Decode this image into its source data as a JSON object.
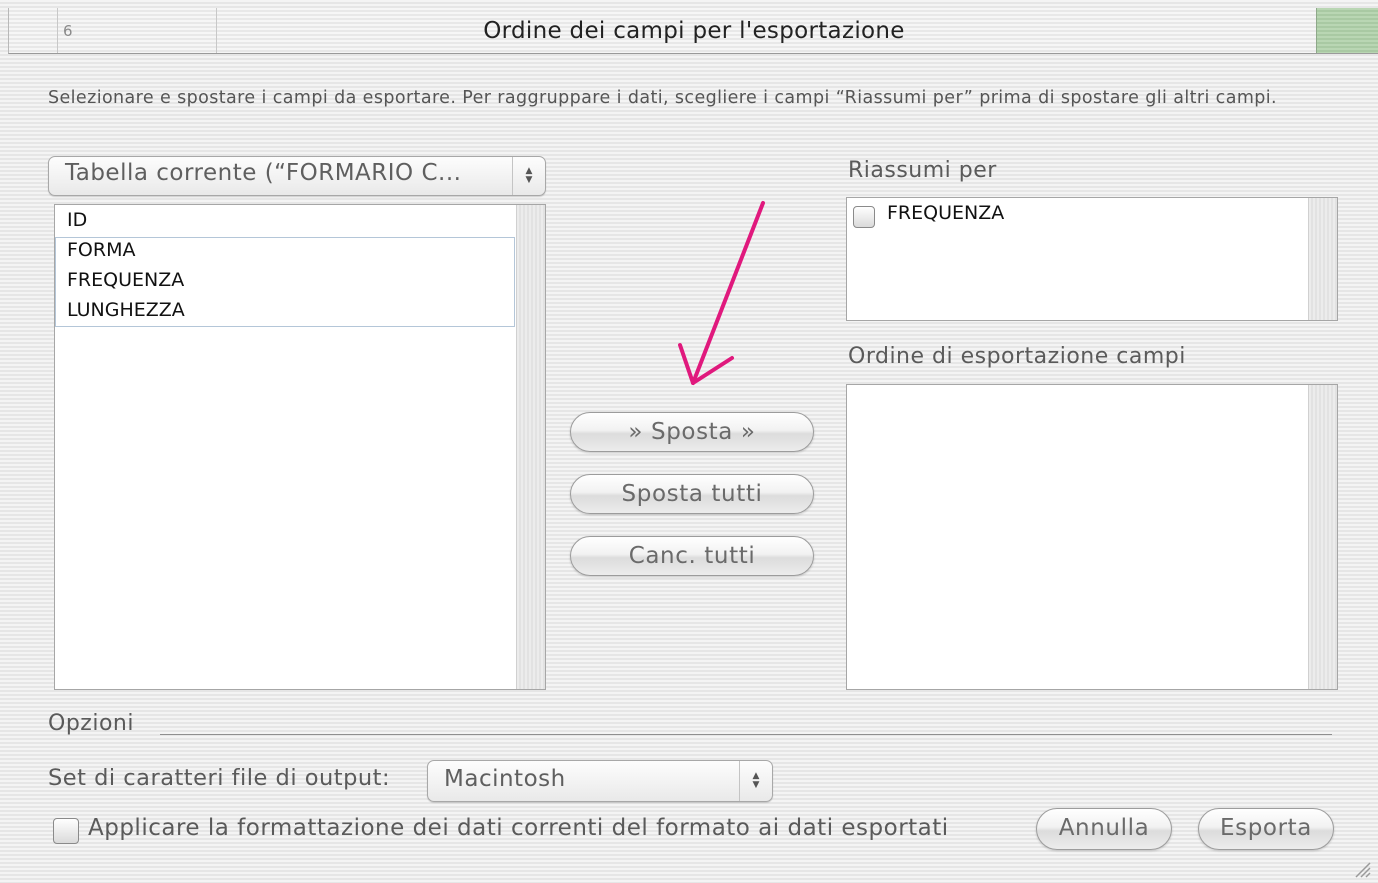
{
  "window": {
    "title": "Ordine dei campi per l'esportazione",
    "background_cell_value": "6"
  },
  "instructions": "Selezionare e spostare i campi da esportare.  Per raggruppare i dati, scegliere i campi “Riassumi per” prima di spostare gli altri campi.",
  "source": {
    "table_popup_label": "Tabella corrente (“FORMARIO C...",
    "fields": [
      "ID",
      "FORMA",
      "FREQUENZA",
      "LUNGHEZZA"
    ]
  },
  "summarize": {
    "label": "Riassumi per",
    "items": [
      {
        "label": "FREQUENZA",
        "checked": false
      }
    ]
  },
  "export_order": {
    "label": "Ordine di esportazione campi",
    "items": []
  },
  "actions": {
    "move": "» Sposta »",
    "move_all": "Sposta tutti",
    "clear_all": "Canc. tutti"
  },
  "options": {
    "label": "Opzioni",
    "charset_label": "Set di caratteri file di output:",
    "charset_value": "Macintosh",
    "apply_format_label": "Applicare la formattazione dei dati correnti del formato ai dati esportati",
    "apply_format_checked": false
  },
  "footer": {
    "cancel": "Annulla",
    "export": "Esporta"
  },
  "annotation": {
    "color": "#e0197d",
    "icon": "arrow-annotation"
  },
  "colors": {
    "annotation_arrow": "#e0197d",
    "title_green": "#b9d6b3"
  }
}
